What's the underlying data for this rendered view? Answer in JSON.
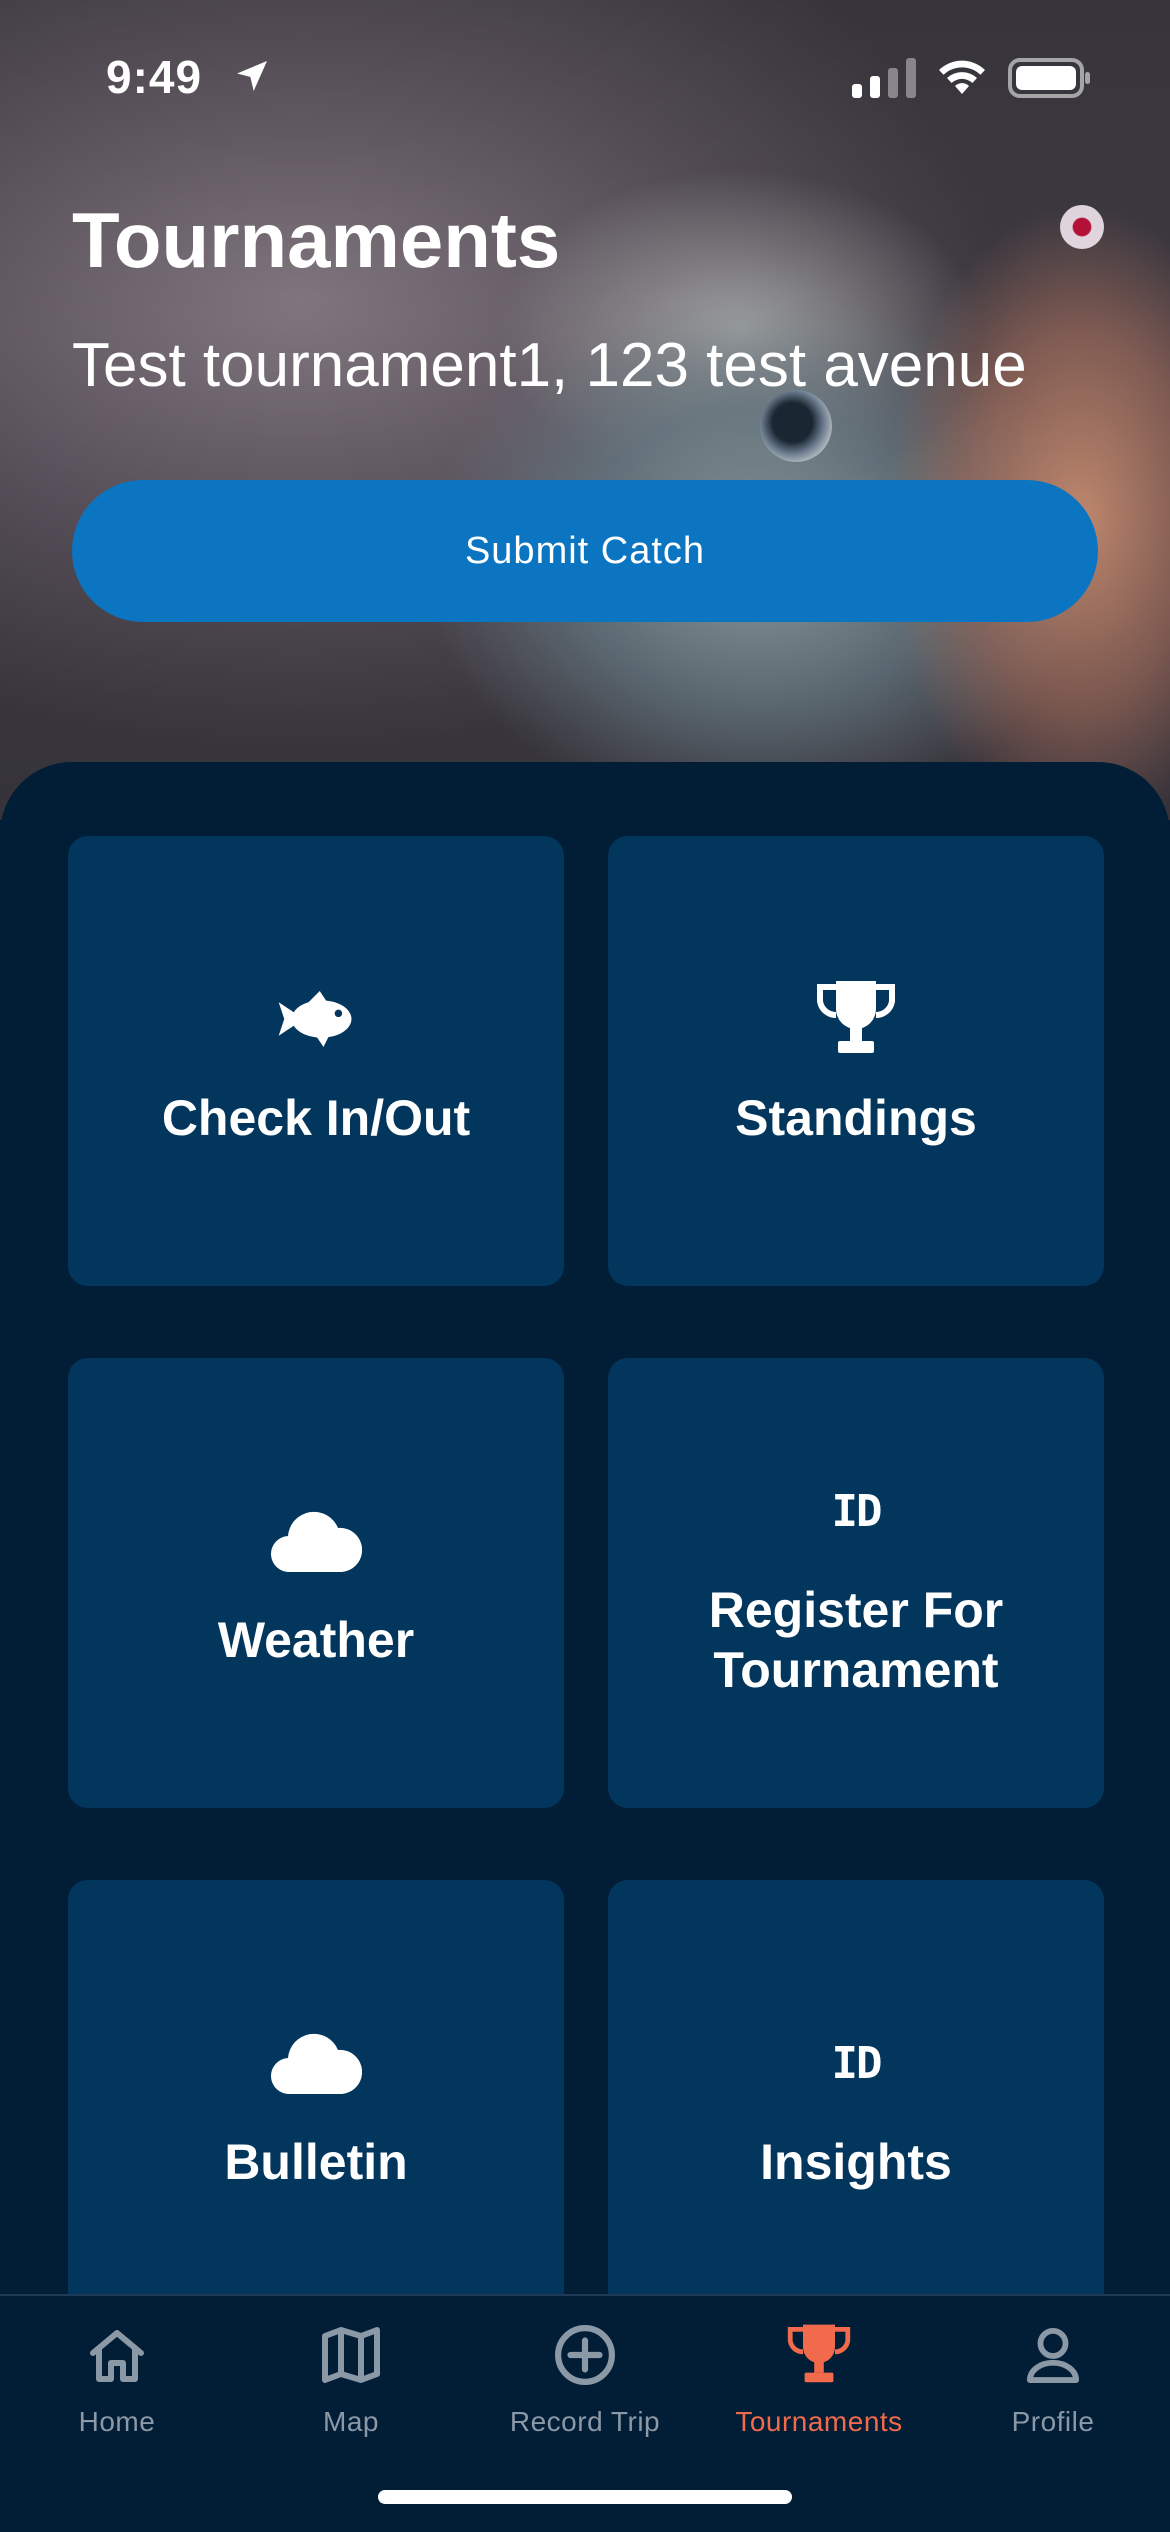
{
  "status_bar": {
    "time": "9:49"
  },
  "header": {
    "title": "Tournaments",
    "subtitle": "Test tournament1, 123 test avenue",
    "submit_label": "Submit Catch"
  },
  "tiles": [
    {
      "label": "Check In/Out",
      "icon": "fish-icon"
    },
    {
      "label": "Standings",
      "icon": "trophy-icon"
    },
    {
      "label": "Weather",
      "icon": "cloud-icon"
    },
    {
      "label": "Register For Tournament",
      "icon": "id-icon",
      "icon_text": "ID"
    },
    {
      "label": "Bulletin",
      "icon": "cloud-icon"
    },
    {
      "label": "Insights",
      "icon": "id-icon",
      "icon_text": "ID"
    }
  ],
  "tabbar": {
    "items": [
      {
        "label": "Home",
        "icon": "home-icon"
      },
      {
        "label": "Map",
        "icon": "map-icon"
      },
      {
        "label": "Record Trip",
        "icon": "plus-circle-icon"
      },
      {
        "label": "Tournaments",
        "icon": "trophy-icon",
        "active": true
      },
      {
        "label": "Profile",
        "icon": "person-icon"
      }
    ]
  },
  "colors": {
    "background": "#021d36",
    "tile": "#03365d",
    "primary_button": "#0b75c2",
    "active_tab": "#f06a4b",
    "inactive_tab": "#8b98a6"
  }
}
